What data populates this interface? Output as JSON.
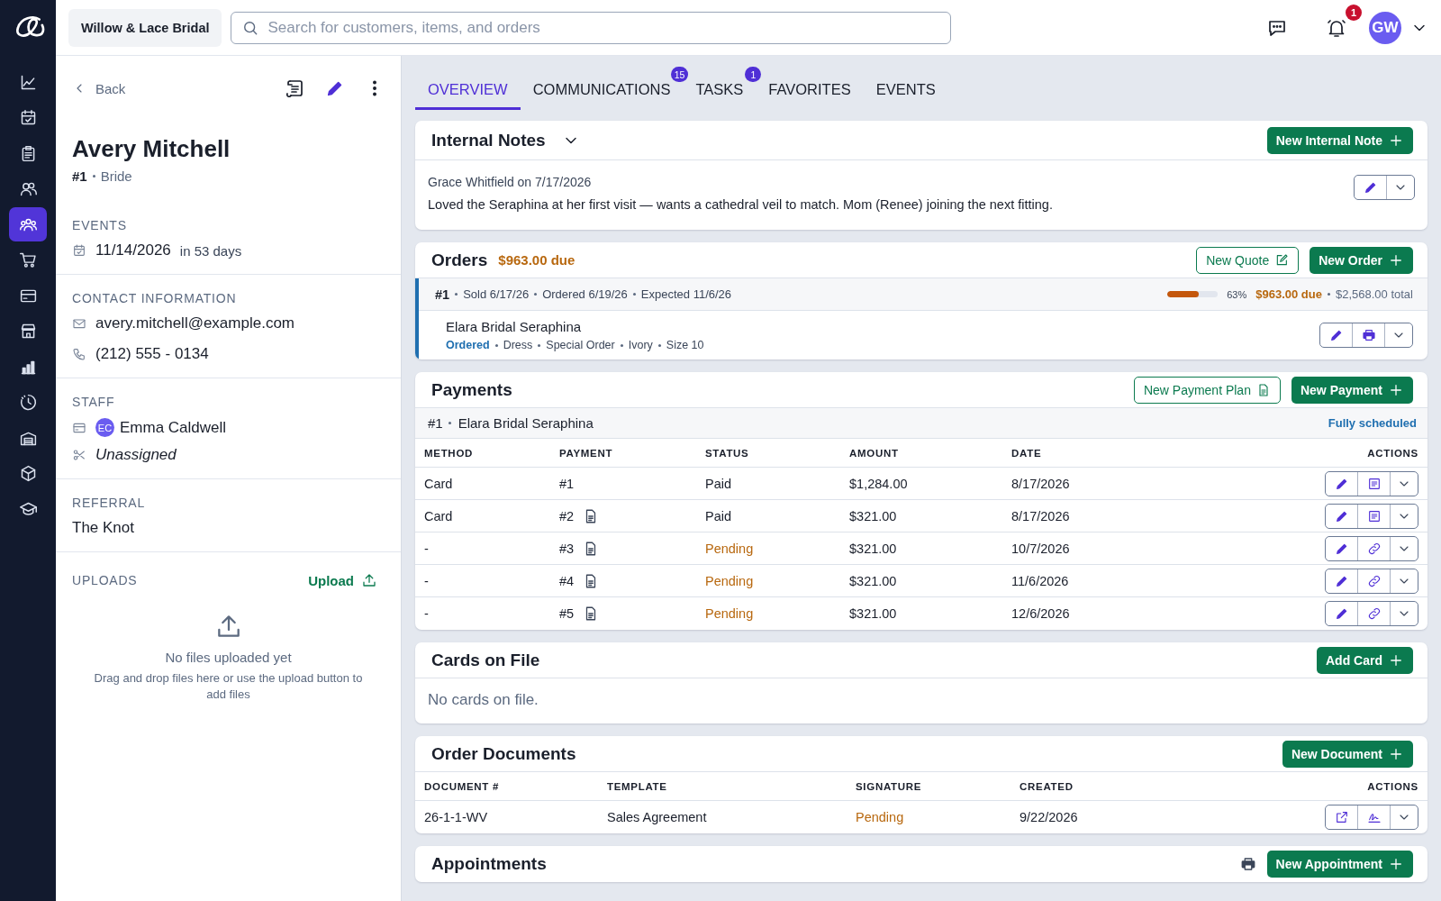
{
  "brand": {
    "store": "Willow & Lace Bridal"
  },
  "search": {
    "placeholder": "Search for customers, items, and orders"
  },
  "header": {
    "notification_count": "1",
    "avatar": "GW"
  },
  "rail": {
    "items": [
      {
        "selected": false
      },
      {
        "selected": false
      },
      {
        "selected": false
      },
      {
        "selected": false
      },
      {
        "selected": true
      },
      {
        "selected": false
      },
      {
        "selected": false
      },
      {
        "selected": false
      },
      {
        "selected": false
      },
      {
        "selected": false
      },
      {
        "selected": false
      },
      {
        "selected": false
      },
      {
        "selected": false
      }
    ]
  },
  "customer": {
    "back": "Back",
    "name": "Avery Mitchell",
    "number": "#1",
    "role": "Bride",
    "events": {
      "heading": "EVENTS",
      "date": "11/14/2026",
      "relative": "in 53 days"
    },
    "contact": {
      "heading": "CONTACT INFORMATION",
      "email": "avery.mitchell@example.com",
      "phone": "(212) 555 - 0134"
    },
    "staff": {
      "heading": "STAFF",
      "initials": "EC",
      "name": "Emma Caldwell",
      "stylist": "Unassigned"
    },
    "referral": {
      "heading": "REFERRAL",
      "value": "The Knot"
    },
    "uploads": {
      "heading": "UPLOADS",
      "action": "Upload",
      "empty_title": "No files uploaded yet",
      "empty_hint": "Drag and drop files here or use the upload button to add files"
    }
  },
  "tabs": [
    {
      "label": "OVERVIEW",
      "selected": true
    },
    {
      "label": "COMMUNICATIONS",
      "badge": "15",
      "selected": false
    },
    {
      "label": "TASKS",
      "badge": "1",
      "selected": false
    },
    {
      "label": "FAVORITES",
      "selected": false
    },
    {
      "label": "EVENTS",
      "selected": false
    }
  ],
  "internal_notes": {
    "title": "Internal Notes",
    "action": "New Internal Note",
    "notes": [
      {
        "author": "Grace Whitfield on 7/17/2026",
        "text": "Loved the Seraphina at her first visit — wants a cathedral veil to match. Mom (Renee) joining the next fitting."
      }
    ]
  },
  "orders": {
    "title": "Orders",
    "due": "$963.00 due",
    "quote_action": "New Quote",
    "order_action": "New Order",
    "order": {
      "number": "#1",
      "meta": [
        "Sold 6/17/26",
        "Ordered 6/19/26",
        "Expected 11/6/26"
      ],
      "level": 0.63,
      "percent": "63%",
      "due": "$963.00 due",
      "total": "$2,568.00 total",
      "items": [
        {
          "name": "Elara Bridal Seraphina",
          "status": "Ordered",
          "details": [
            "Dress",
            "Special Order",
            "Ivory",
            "Size 10"
          ]
        }
      ]
    }
  },
  "payments": {
    "title": "Payments",
    "plan_action": "New Payment Plan",
    "payment_action": "New Payment",
    "group": {
      "number": "#1",
      "name": "Elara Bridal Seraphina",
      "status": "Fully scheduled"
    },
    "columns": [
      "METHOD",
      "PAYMENT",
      "STATUS",
      "AMOUNT",
      "DATE",
      "ACTIONS"
    ],
    "rows": [
      {
        "method": "Card",
        "payment": "#1",
        "document": false,
        "status": "Paid",
        "kind": "paid",
        "amount": "$1,284.00",
        "date": "8/17/2026",
        "payment_link": false
      },
      {
        "method": "Card",
        "payment": "#2",
        "document": true,
        "status": "Paid",
        "kind": "paid",
        "amount": "$321.00",
        "date": "8/17/2026",
        "payment_link": false
      },
      {
        "method": "-",
        "payment": "#3",
        "document": true,
        "status": "Pending",
        "kind": "pending",
        "amount": "$321.00",
        "date": "10/7/2026",
        "payment_link": true
      },
      {
        "method": "-",
        "payment": "#4",
        "document": true,
        "status": "Pending",
        "kind": "pending",
        "amount": "$321.00",
        "date": "11/6/2026",
        "payment_link": true
      },
      {
        "method": "-",
        "payment": "#5",
        "document": true,
        "status": "Pending",
        "kind": "pending",
        "amount": "$321.00",
        "date": "12/6/2026",
        "payment_link": true
      }
    ]
  },
  "cards_on_file": {
    "title": "Cards on File",
    "action": "Add Card",
    "empty": "No cards on file."
  },
  "order_documents": {
    "title": "Order Documents",
    "action": "New Document",
    "columns": [
      "DOCUMENT #",
      "TEMPLATE",
      "SIGNATURE",
      "CREATED",
      "ACTIONS"
    ],
    "rows": [
      {
        "document": "26-1-1-WV",
        "template": "Sales Agreement",
        "signature": "Pending",
        "kind": "pending",
        "created": "9/22/2026"
      }
    ]
  },
  "appointments": {
    "title": "Appointments",
    "action": "New Appointment"
  }
}
